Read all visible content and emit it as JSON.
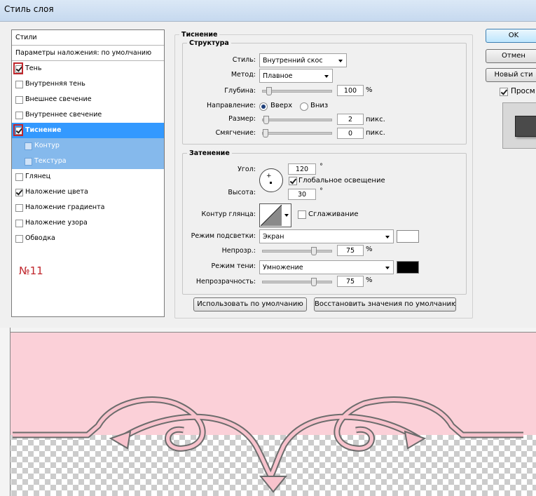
{
  "window": {
    "title": "Стиль слоя"
  },
  "styles_list": {
    "header": "Стили",
    "blend_defaults": "Параметры наложения: по умолчанию",
    "items": [
      {
        "label": "Тень",
        "checked": true
      },
      {
        "label": "Внутренняя тень",
        "checked": false
      },
      {
        "label": "Внешнее свечение",
        "checked": false
      },
      {
        "label": "Внутреннее свечение",
        "checked": false
      },
      {
        "label": "Тиснение",
        "checked": true,
        "selected": true
      },
      {
        "label": "Контур",
        "checked": false,
        "sub": true
      },
      {
        "label": "Текстура",
        "checked": false,
        "sub": true
      },
      {
        "label": "Глянец",
        "checked": false
      },
      {
        "label": "Наложение цвета",
        "checked": true
      },
      {
        "label": "Наложение градиента",
        "checked": false
      },
      {
        "label": "Наложение узора",
        "checked": false
      },
      {
        "label": "Обводка",
        "checked": false
      }
    ],
    "note": "№11"
  },
  "emboss": {
    "title": "Тиснение",
    "structure": {
      "title": "Структура",
      "style_label": "Стиль:",
      "style_value": "Внутренний скос",
      "method_label": "Метод:",
      "method_value": "Плавное",
      "depth_label": "Глубина:",
      "depth_value": "100",
      "depth_unit": "%",
      "depth_level": 0.05,
      "direction_label": "Направление:",
      "dir_up": "Вверх",
      "dir_down": "Вниз",
      "size_label": "Размер:",
      "size_value": "2",
      "size_unit": "пикс.",
      "size_level": 0.01,
      "soften_label": "Смягчение:",
      "soften_value": "0",
      "soften_unit": "пикс.",
      "soften_level": 0
    },
    "shading": {
      "title": "Затенение",
      "angle_label": "Угол:",
      "angle_value": "120",
      "angle_unit": "°",
      "global_light": "Глобальное освещение",
      "altitude_label": "Высота:",
      "altitude_value": "30",
      "altitude_unit": "°",
      "gloss_contour_label": "Контур глянца:",
      "antialias": "Сглаживание",
      "highlight_mode_label": "Режим подсветки:",
      "highlight_mode_value": "Экран",
      "highlight_color": "#ffffff",
      "highlight_opacity_label": "Непрозр.:",
      "highlight_opacity_value": "75",
      "highlight_opacity_unit": "%",
      "highlight_opacity_level": 0.75,
      "shadow_mode_label": "Режим тени:",
      "shadow_mode_value": "Умножение",
      "shadow_color": "#000000",
      "shadow_opacity_label": "Непрозрачность:",
      "shadow_opacity_value": "75",
      "shadow_opacity_unit": "%",
      "shadow_opacity_level": 0.75
    },
    "make_default": "Использовать по умолчанию",
    "reset_default": "Восстановить значения по умолчанию"
  },
  "right_buttons": {
    "ok": "OK",
    "cancel": "Отмен",
    "new_style": "Новый сти",
    "preview": "Просм"
  },
  "colors": {
    "selected": "#3399ff",
    "sub_selected": "#85b9ec",
    "pink_band": "#fbd0d8",
    "note_red": "#c0272d"
  }
}
